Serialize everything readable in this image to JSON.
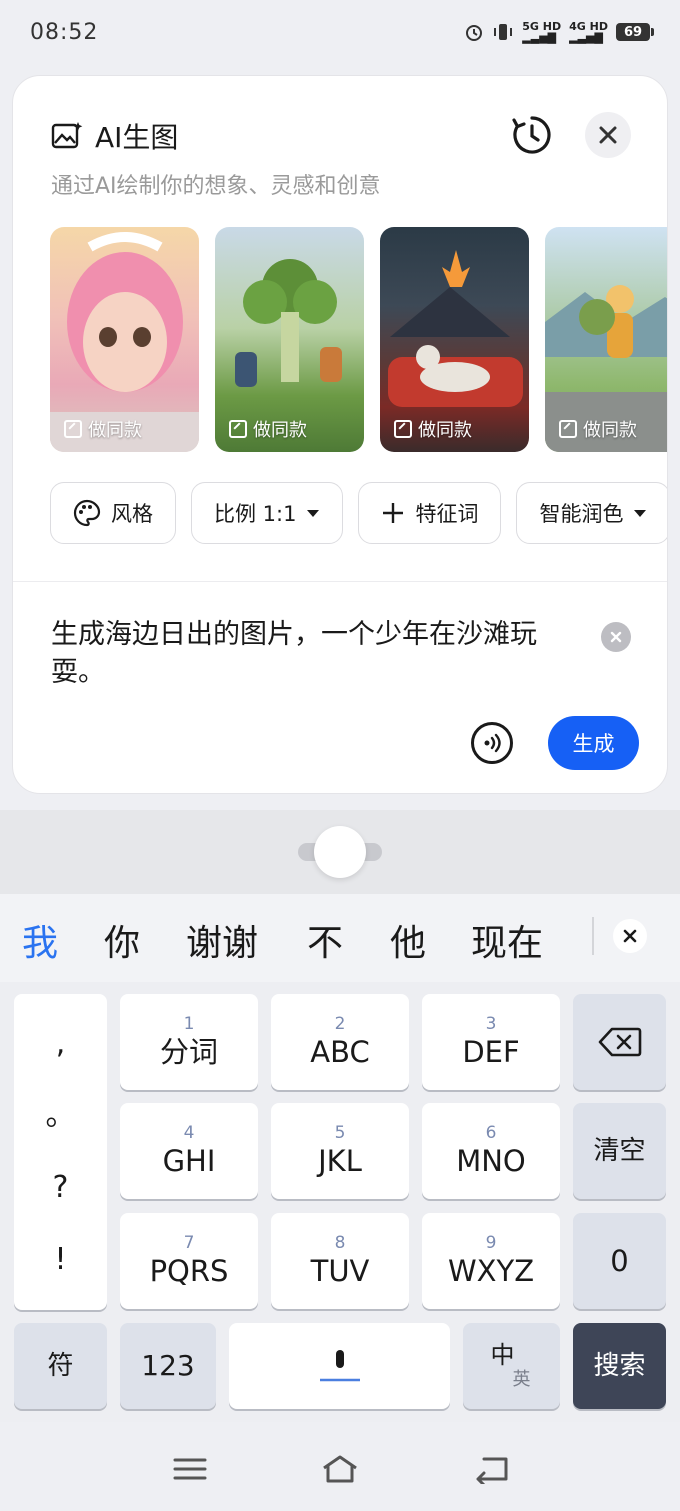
{
  "status_bar": {
    "time": "08:52",
    "net1": "5G HD",
    "net2": "4G HD",
    "battery": "69"
  },
  "card": {
    "title": "AI生图",
    "subtitle": "通过AI绘制你的想象、灵感和创意",
    "gallery": [
      {
        "badge": "做同款"
      },
      {
        "badge": "做同款"
      },
      {
        "badge": "做同款"
      },
      {
        "badge": "做同款"
      }
    ],
    "chips": [
      {
        "label": "风格"
      },
      {
        "label": "比例 1:1"
      },
      {
        "label": "特征词"
      },
      {
        "label": "智能润色"
      }
    ],
    "prompt": "生成海边日出的图片，一个少年在沙滩玩耍。",
    "generate_label": "生成"
  },
  "candidates": [
    "我",
    "你",
    "谢谢",
    "不",
    "他",
    "现在"
  ],
  "keyboard": {
    "punct": [
      ",",
      "。",
      "?",
      "!"
    ],
    "keys": [
      {
        "num": "1",
        "label": "分词"
      },
      {
        "num": "2",
        "label": "ABC"
      },
      {
        "num": "3",
        "label": "DEF"
      },
      {
        "num": "4",
        "label": "GHI"
      },
      {
        "num": "5",
        "label": "JKL"
      },
      {
        "num": "6",
        "label": "MNO"
      },
      {
        "num": "7",
        "label": "PQRS"
      },
      {
        "num": "8",
        "label": "TUV"
      },
      {
        "num": "9",
        "label": "WXYZ"
      }
    ],
    "clear": "清空",
    "zero": "0",
    "symbol": "符",
    "numbers": "123",
    "lang_main": "中",
    "lang_alt": "英",
    "search": "搜索"
  },
  "colors": {
    "accent": "#1660f5",
    "candidate_active": "#2a73f0",
    "search_key": "#3e4557"
  }
}
